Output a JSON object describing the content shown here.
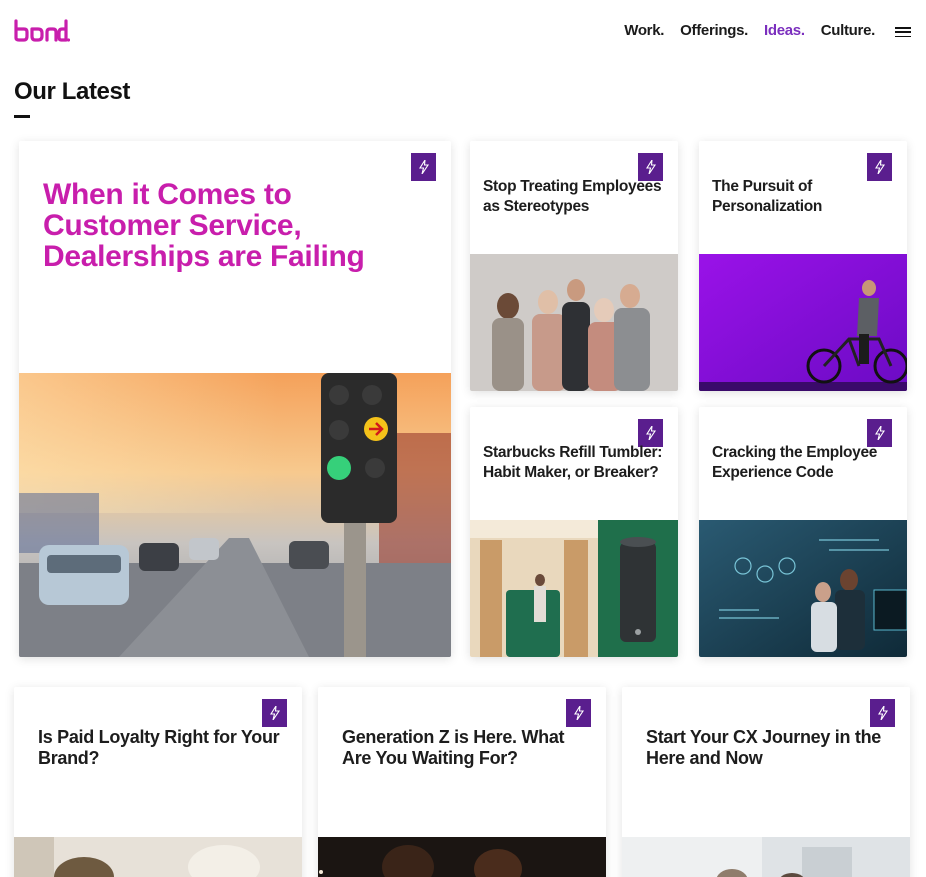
{
  "brand": {
    "logo_text": "bond.",
    "accent_color": "#c81eac",
    "badge_color": "#5a1e8e",
    "active_nav_color": "#7b2fbe"
  },
  "nav": {
    "items": [
      {
        "label": "Work."
      },
      {
        "label": "Offerings."
      },
      {
        "label": "Ideas."
      },
      {
        "label": "Culture."
      }
    ],
    "menu_icon": "hamburger-icon"
  },
  "section": {
    "title": "Our Latest"
  },
  "cards": [
    {
      "title": "When it Comes to Customer Service, Dealerships are Failing",
      "badge_icon": "lightning-icon"
    },
    {
      "title": "Stop Treating Employees as Stereotypes",
      "badge_icon": "lightning-icon"
    },
    {
      "title": "The Pursuit of Personalization",
      "badge_icon": "lightning-icon"
    },
    {
      "title": "Starbucks Refill Tumbler: Habit Maker, or Breaker?",
      "badge_icon": "lightning-icon"
    },
    {
      "title": "Cracking the Employee Experience Code",
      "badge_icon": "lightning-icon"
    },
    {
      "title": "Is Paid Loyalty Right for Your Brand?",
      "badge_icon": "lightning-icon"
    },
    {
      "title": "Generation Z is Here. What Are You Waiting For?",
      "badge_icon": "lightning-icon"
    },
    {
      "title": "Start Your CX Journey in the Here and Now",
      "badge_icon": "lightning-icon"
    }
  ]
}
